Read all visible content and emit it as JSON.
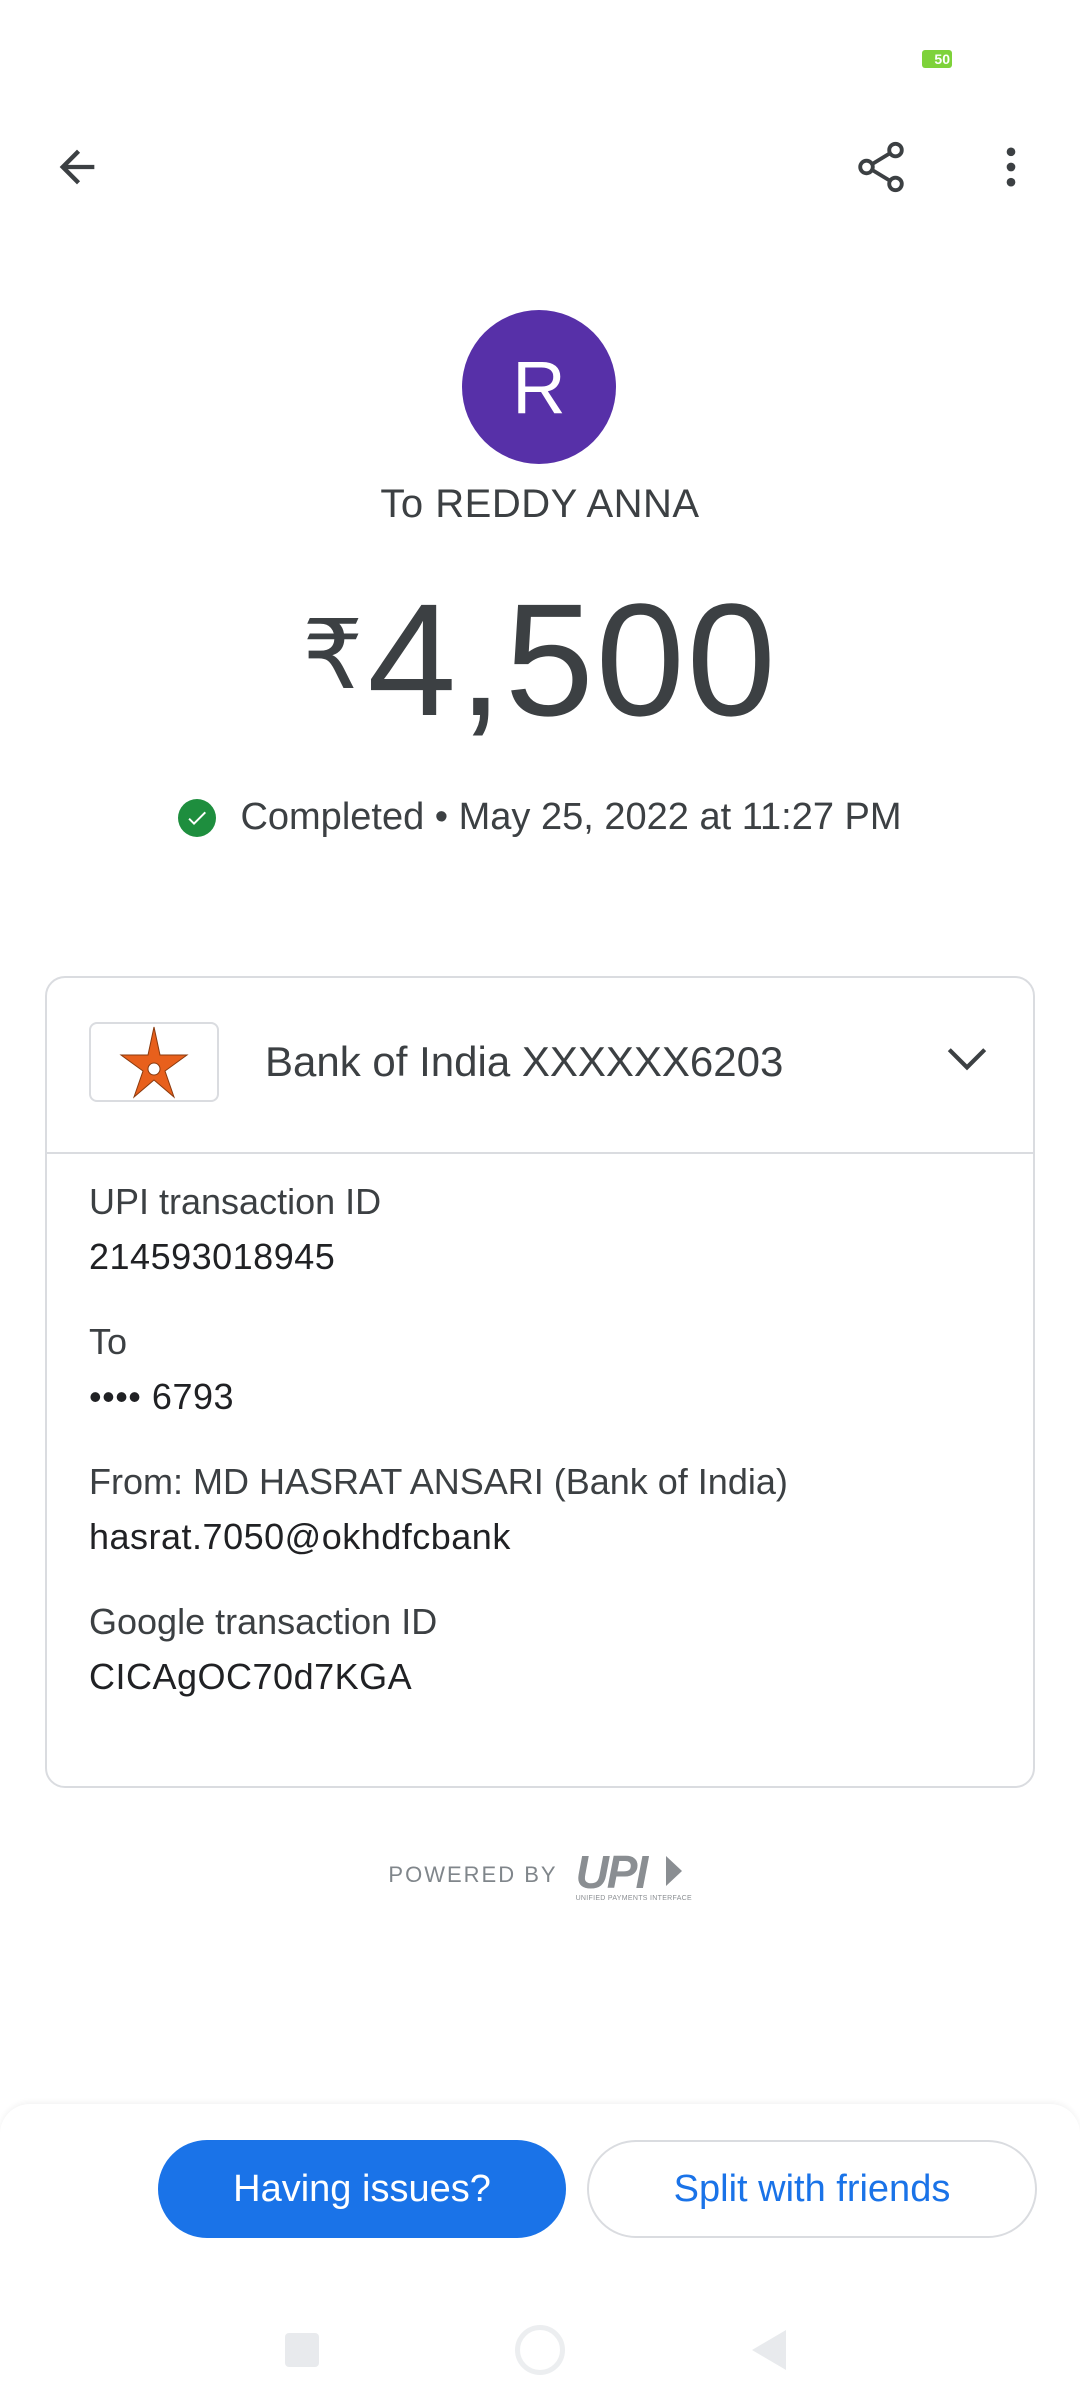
{
  "status_bar": {
    "battery_level": "50",
    "battery_color": "#7ed23a"
  },
  "header": {
    "back_icon": "arrow-left-icon",
    "share_icon": "share-icon",
    "more_icon": "more-vert-icon"
  },
  "payee": {
    "avatar_initial": "R",
    "avatar_color": "#5730a8",
    "to_text": "To REDDY ANNA"
  },
  "payment": {
    "currency_symbol": "₹",
    "amount": "4,500",
    "status_text": "Completed • May 25, 2022 at 11:27 PM",
    "status_color": "#1e8e3e"
  },
  "bank": {
    "name": "Bank of India XXXXXX6203",
    "logo_icon": "bank-of-india-star-logo",
    "expand_icon": "chevron-down-icon"
  },
  "details": [
    {
      "label": "UPI transaction ID",
      "value": "214593018945"
    },
    {
      "label": "To",
      "value": "•••• 6793"
    },
    {
      "label": "From: MD HASRAT ANSARI (Bank of India)",
      "value": "hasrat.7050@okhdfcbank"
    },
    {
      "label": "Google transaction ID",
      "value": "CICAgOC70d7KGA"
    }
  ],
  "footer": {
    "powered_by": "POWERED BY",
    "upi_logo_text": "UPI",
    "upi_logo_subtext": "UNIFIED PAYMENTS INTERFACE"
  },
  "actions": {
    "having_issues": "Having issues?",
    "split_with_friends": "Split with friends",
    "primary_color": "#1a73e8"
  }
}
